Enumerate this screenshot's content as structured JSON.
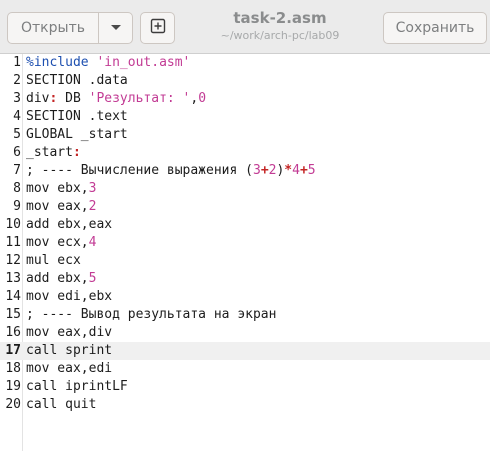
{
  "header": {
    "open_label": "Открыть",
    "save_label": "Сохранить",
    "title": "task-2.asm",
    "subtitle": "~/work/arch-pc/lab09"
  },
  "icons": {
    "open_menu": "chevron-down-icon",
    "new_tab": "new-tab-icon"
  },
  "editor": {
    "current_line": 17,
    "lines": [
      {
        "n": "1",
        "text": "%include 'in_out.asm'"
      },
      {
        "n": "2",
        "text": "SECTION .data"
      },
      {
        "n": "3",
        "text": "div: DB 'Результат: ',0"
      },
      {
        "n": "4",
        "text": "SECTION .text"
      },
      {
        "n": "5",
        "text": "GLOBAL _start"
      },
      {
        "n": "6",
        "text": "_start:"
      },
      {
        "n": "7",
        "text": "; ---- Вычисление выражения (3+2)*4+5"
      },
      {
        "n": "8",
        "text": "mov ebx,3"
      },
      {
        "n": "9",
        "text": "mov eax,2"
      },
      {
        "n": "10",
        "text": "add ebx,eax"
      },
      {
        "n": "11",
        "text": "mov ecx,4"
      },
      {
        "n": "12",
        "text": "mul ecx"
      },
      {
        "n": "13",
        "text": "add ebx,5"
      },
      {
        "n": "14",
        "text": "mov edi,ebx"
      },
      {
        "n": "15",
        "text": "; ---- Вывод результата на экран"
      },
      {
        "n": "16",
        "text": "mov eax,div"
      },
      {
        "n": "17",
        "text": "call sprint"
      },
      {
        "n": "18",
        "text": "mov eax,edi"
      },
      {
        "n": "19",
        "text": "call iprintLF"
      },
      {
        "n": "20",
        "text": "call quit"
      }
    ]
  }
}
